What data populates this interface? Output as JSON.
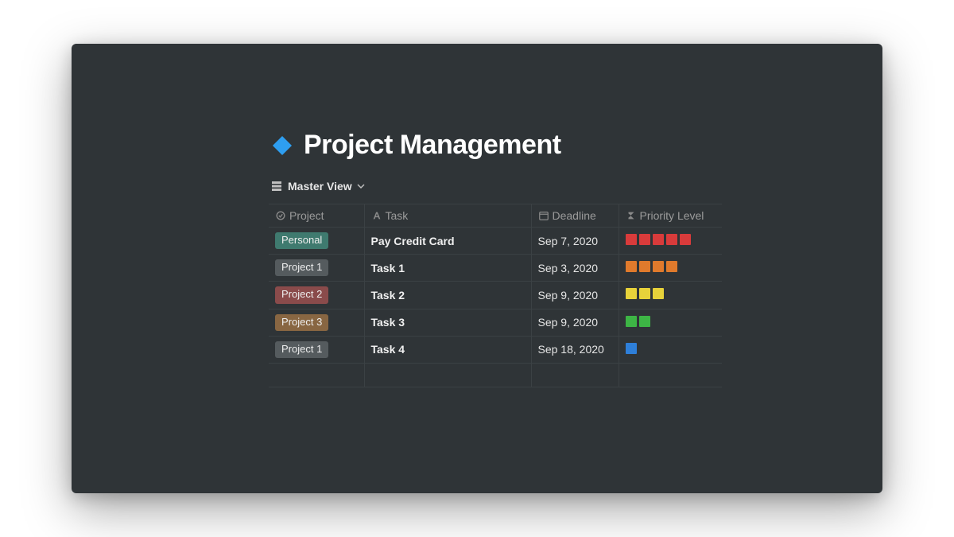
{
  "page": {
    "title": "Project Management",
    "icon_color": "#2e9ef0"
  },
  "view": {
    "label": "Master View"
  },
  "columns": {
    "project": "Project",
    "task": "Task",
    "deadline": "Deadline",
    "priority": "Priority Level"
  },
  "tag_colors": {
    "Personal": "#3f7a6f",
    "Project 1": "#555b5e",
    "Project 2": "#8a4b4b",
    "Project 3": "#886642"
  },
  "priority_colors": {
    "5": "#d93b3b",
    "4": "#e07a2c",
    "3": "#e7d23a",
    "2": "#3db545",
    "1": "#2e7fd9"
  },
  "rows": [
    {
      "project": "Personal",
      "task": "Pay Credit Card",
      "deadline": "Sep 7, 2020",
      "priority": 5
    },
    {
      "project": "Project 1",
      "task": "Task 1",
      "deadline": "Sep 3, 2020",
      "priority": 4
    },
    {
      "project": "Project 2",
      "task": "Task 2",
      "deadline": "Sep 9, 2020",
      "priority": 3
    },
    {
      "project": "Project 3",
      "task": "Task 3",
      "deadline": "Sep 9, 2020",
      "priority": 2
    },
    {
      "project": "Project 1",
      "task": "Task 4",
      "deadline": "Sep 18, 2020",
      "priority": 1
    }
  ]
}
